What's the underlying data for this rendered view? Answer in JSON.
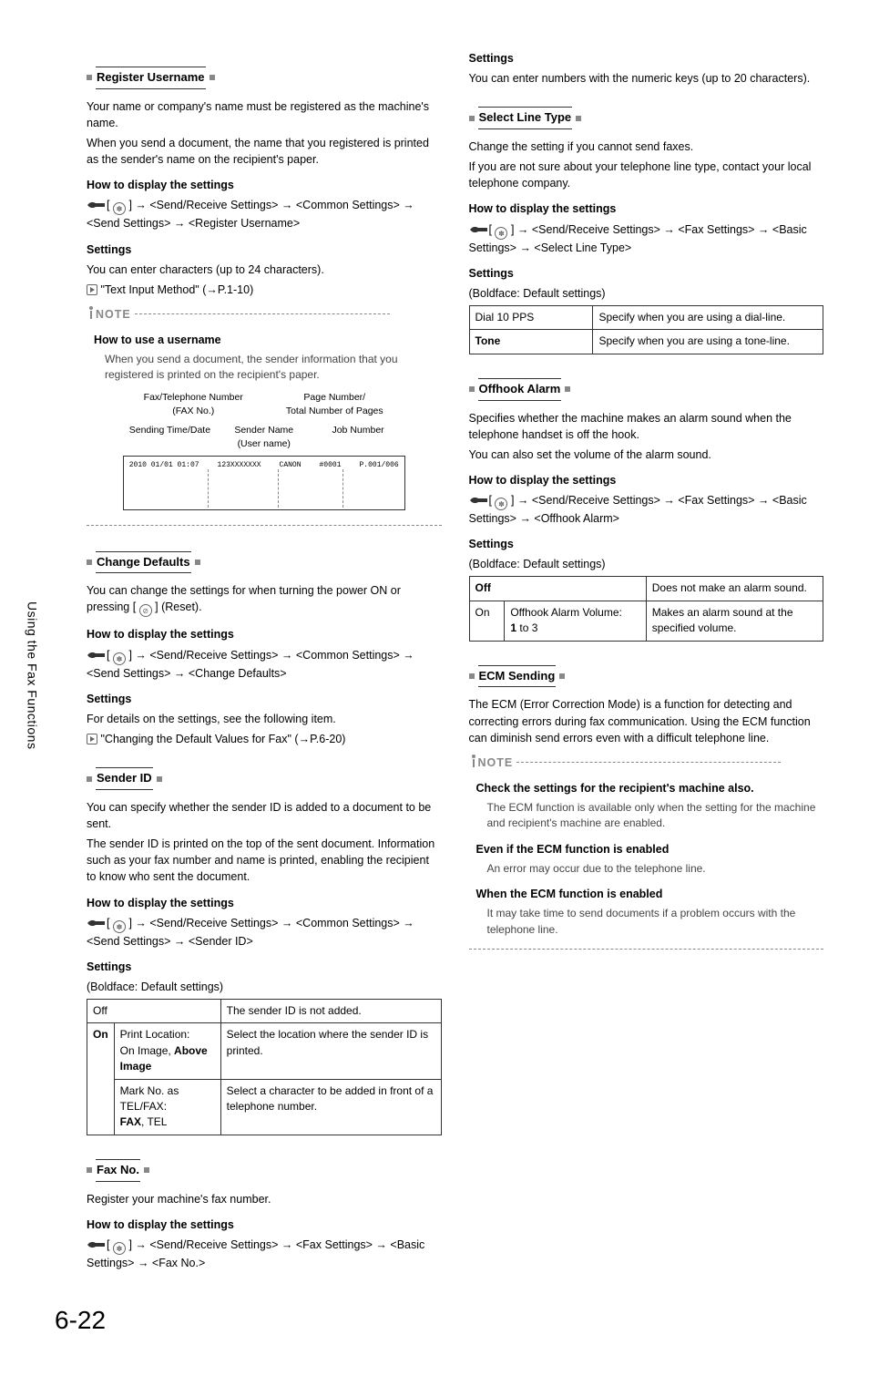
{
  "side_tab": "Using the Fax Functions",
  "page_number": "6-22",
  "arrow": "→",
  "left": {
    "register_username": {
      "title": "Register Username",
      "p1": "Your name or company's name must be registered as the machine's name.",
      "p2": "When you send a document, the name that you registered is printed as the sender's name on the recipient's paper.",
      "how_title": "How to display the settings",
      "how_path": "] → <Send/Receive Settings> → <Common Settings> → <Send Settings> → <Register Username>",
      "settings_title": "Settings",
      "settings_p1": "You can enter characters (up to 24 characters).",
      "settings_ref": "\"Text Input Method\" (→P.1-10)",
      "note_label": "NOTE",
      "note_sub": "How to use a username",
      "note_p": "When you send a document, the sender information that you registered is printed on the recipient's paper.",
      "diag": {
        "top_left": "Fax/Telephone Number\n(FAX No.)",
        "top_right": "Page Number/\nTotal Number of Pages",
        "mid_left": "Sending Time/Date",
        "mid_center": "Sender Name\n(User name)",
        "mid_right": "Job Number",
        "strip_a": "2010 01/01 01:07",
        "strip_b": "123XXXXXXX",
        "strip_c": "CANON",
        "strip_d": "#0001",
        "strip_e": "P.001/006"
      }
    },
    "change_defaults": {
      "title": "Change Defaults",
      "p1": "You can change the settings for when turning the power ON or pressing [",
      "p1b": "] (Reset).",
      "how_title": "How to display the settings",
      "how_path": "] → <Send/Receive Settings> → <Common Settings> → <Send Settings> → <Change Defaults>",
      "settings_title": "Settings",
      "settings_p1": "For details on the settings, see the following item.",
      "settings_ref": "\"Changing the Default Values for Fax\" (→P.6-20)"
    },
    "sender_id": {
      "title": "Sender ID",
      "p1": "You can specify whether the sender ID is added to a document to be sent.",
      "p2": "The sender ID is printed on the top of the sent document. Information such as your fax number and name is printed, enabling the recipient to know who sent the document.",
      "how_title": "How to display the settings",
      "how_path": "] → <Send/Receive Settings> → <Common Settings> → <Send Settings> → <Sender ID>",
      "settings_title": "Settings",
      "settings_note": "(Boldface: Default settings)",
      "table": {
        "off": "Off",
        "off_desc": "The sender ID is not added.",
        "on": "On",
        "r1a": "Print Location:",
        "r1b": "On Image, ",
        "r1b_bold": "Above Image",
        "r1_desc": "Select the location where the sender ID is printed.",
        "r2a": "Mark No. as TEL/FAX:",
        "r2b_bold": "FAX",
        "r2b": ", TEL",
        "r2_desc": "Select a character to be added in front of a telephone number."
      }
    },
    "fax_no": {
      "title": "Fax No.",
      "p1": "Register your machine's fax number.",
      "how_title": "How to display the settings",
      "how_path": "] → <Send/Receive Settings> → <Fax Settings> → <Basic Settings> → <Fax No.>"
    }
  },
  "right": {
    "fax_no_settings": {
      "title": "Settings",
      "p1": "You can enter numbers with the numeric keys (up to 20 characters)."
    },
    "select_line": {
      "title": "Select Line Type",
      "p1": "Change the setting if you cannot send faxes.",
      "p2": "If you are not sure about your telephone line type, contact your local telephone company.",
      "how_title": "How to display the settings",
      "how_path": "] → <Send/Receive Settings> → <Fax Settings> → <Basic Settings> → <Select Line Type>",
      "settings_title": "Settings",
      "settings_note": "(Boldface: Default settings)",
      "table": {
        "r1a": "Dial 10 PPS",
        "r1b": "Specify when you are using a dial-line.",
        "r2a": "Tone",
        "r2b": "Specify when you are using a tone-line."
      }
    },
    "offhook": {
      "title": "Offhook Alarm",
      "p1": "Specifies whether the machine makes an alarm sound when the telephone handset is off the hook.",
      "p2": "You can also set the volume of the alarm sound.",
      "how_title": "How to display the settings",
      "how_path": "] → <Send/Receive Settings> → <Fax Settings> → <Basic Settings> → <Offhook Alarm>",
      "settings_title": "Settings",
      "settings_note": "(Boldface: Default settings)",
      "table": {
        "off": "Off",
        "off_desc": "Does not make an alarm sound.",
        "on": "On",
        "r1a": "Offhook Alarm Volume:",
        "r1b_bold": "1",
        "r1b": " to 3",
        "r1_desc": "Makes an alarm sound at the specified volume."
      }
    },
    "ecm": {
      "title": "ECM Sending",
      "p1": "The ECM (Error Correction Mode) is a function for detecting and correcting errors during fax communication. Using the ECM function can diminish send errors even with a difficult telephone line.",
      "note_label": "NOTE",
      "n1_title": "Check the settings for the recipient's machine also.",
      "n1_p": "The ECM function is available only when the setting for the machine and recipient's machine are enabled.",
      "n2_title": "Even if the ECM function is enabled",
      "n2_p": "An error may occur due to the telephone line.",
      "n3_title": "When the ECM function is enabled",
      "n3_p": "It may take time to send documents if a problem occurs with the telephone line."
    }
  }
}
